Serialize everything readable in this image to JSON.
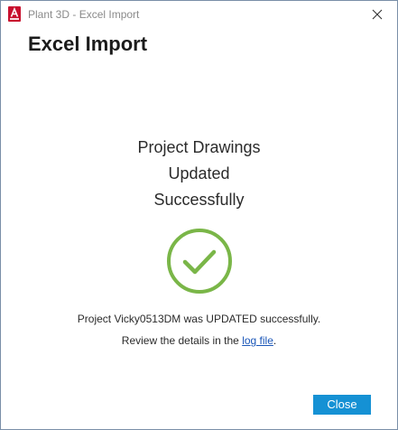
{
  "window": {
    "title": "Plant 3D - Excel Import",
    "app_icon": "autocad-app-icon",
    "close_icon": "close-icon"
  },
  "dialog": {
    "heading": "Excel Import",
    "message_lines": [
      "Project Drawings",
      "Updated",
      "Successfully"
    ],
    "status_icon": "check-circle-icon",
    "detail_line1": "Project Vicky0513DM was UPDATED successfully.",
    "detail_line2_prefix": "Review the details in the ",
    "detail_line2_link": "log file",
    "detail_line2_suffix": ".",
    "close_label": "Close"
  },
  "colors": {
    "success_green": "#7ab648",
    "primary_button": "#1591d4",
    "link": "#1a56b8",
    "app_icon_red": "#c8102e"
  }
}
